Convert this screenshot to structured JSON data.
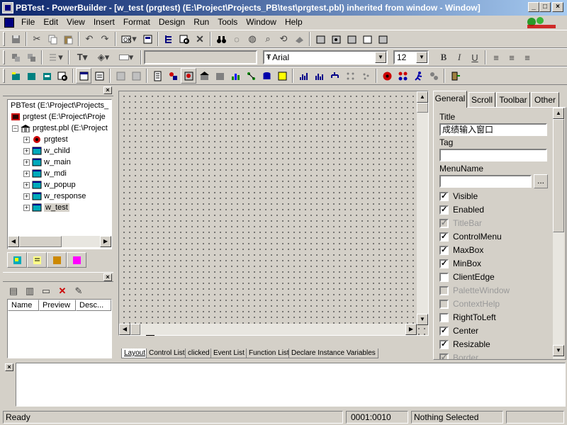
{
  "window": {
    "title": "PBTest - PowerBuilder - [w_test (prgtest) (E:\\Project\\Projects_PB\\test\\prgtest.pbl) inherited from window - Window]"
  },
  "menu": [
    "File",
    "Edit",
    "View",
    "Insert",
    "Format",
    "Design",
    "Run",
    "Tools",
    "Window",
    "Help"
  ],
  "toolbar": {
    "font_name": "Arial",
    "font_size": "12",
    "bold": "B",
    "italic": "I",
    "underline": "U",
    "font_prefix": "Ŧ"
  },
  "library_tree": {
    "root": "PBTest (E:\\Project\\Projects_",
    "target": "prgtest (E:\\Project\\Proje",
    "pbl": "prgtest.pbl (E:\\Project",
    "objects": [
      "prgtest",
      "w_child",
      "w_main",
      "w_mdi",
      "w_popup",
      "w_response",
      "w_test"
    ]
  },
  "list_panel": {
    "columns": [
      "Name",
      "Preview",
      "Desc..."
    ]
  },
  "layout_tabs": [
    "Layout",
    "Control List",
    "clicked",
    "Event List",
    "Function List",
    "Declare Instance Variables"
  ],
  "properties": {
    "tabs": [
      "General",
      "Scroll",
      "Toolbar",
      "Other"
    ],
    "title_label": "Title",
    "title_value": "成绩输入窗口",
    "tag_label": "Tag",
    "tag_value": "",
    "menuname_label": "MenuName",
    "menuname_value": "",
    "browse_label": "...",
    "checkboxes": [
      {
        "label": "Visible",
        "checked": true,
        "enabled": true
      },
      {
        "label": "Enabled",
        "checked": true,
        "enabled": true
      },
      {
        "label": "TitleBar",
        "checked": true,
        "enabled": false
      },
      {
        "label": "ControlMenu",
        "checked": true,
        "enabled": true
      },
      {
        "label": "MaxBox",
        "checked": true,
        "enabled": true
      },
      {
        "label": "MinBox",
        "checked": true,
        "enabled": true
      },
      {
        "label": "ClientEdge",
        "checked": false,
        "enabled": true
      },
      {
        "label": "PaletteWindow",
        "checked": false,
        "enabled": false
      },
      {
        "label": "ContextHelp",
        "checked": false,
        "enabled": false
      },
      {
        "label": "RightToLeft",
        "checked": false,
        "enabled": true
      },
      {
        "label": "Center",
        "checked": true,
        "enabled": true
      },
      {
        "label": "Resizable",
        "checked": true,
        "enabled": true
      },
      {
        "label": "Border",
        "checked": true,
        "enabled": false
      }
    ]
  },
  "status": {
    "message": "Ready",
    "position": "0001:0010",
    "selection": "Nothing Selected"
  },
  "colors": {
    "titlebar_start": "#0a246a",
    "titlebar_end": "#a6caf0",
    "face": "#d4d0c8"
  }
}
